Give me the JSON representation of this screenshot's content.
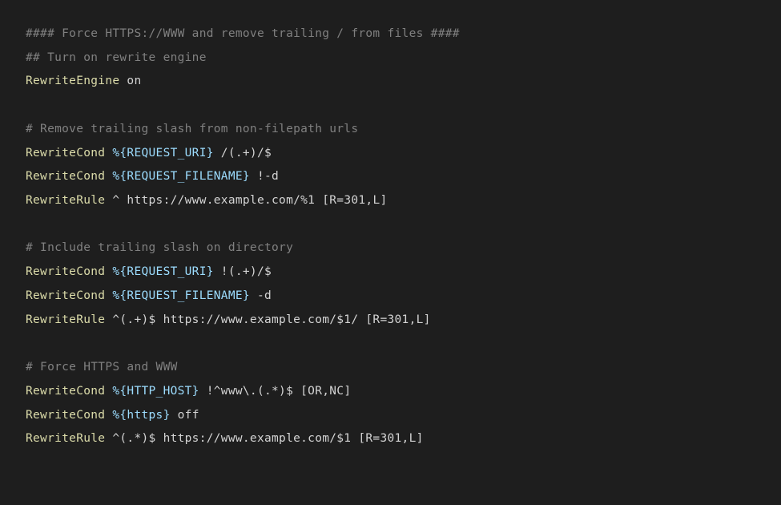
{
  "code": {
    "lines": [
      {
        "segments": [
          {
            "cls": "comment",
            "text": "#### Force HTTPS://WWW and remove trailing / from files ####"
          }
        ]
      },
      {
        "segments": [
          {
            "cls": "comment",
            "text": "## Turn on rewrite engine"
          }
        ]
      },
      {
        "segments": [
          {
            "cls": "directive",
            "text": "RewriteEngine"
          },
          {
            "cls": "value",
            "text": " on"
          }
        ]
      },
      {
        "segments": [
          {
            "cls": "blank",
            "text": " "
          }
        ]
      },
      {
        "segments": [
          {
            "cls": "comment",
            "text": "# Remove trailing slash from non-filepath urls"
          }
        ]
      },
      {
        "segments": [
          {
            "cls": "directive",
            "text": "RewriteCond"
          },
          {
            "cls": "value",
            "text": " "
          },
          {
            "cls": "variable",
            "text": "%{REQUEST_URI}"
          },
          {
            "cls": "value",
            "text": " /(.+)/$"
          }
        ]
      },
      {
        "segments": [
          {
            "cls": "directive",
            "text": "RewriteCond"
          },
          {
            "cls": "value",
            "text": " "
          },
          {
            "cls": "variable",
            "text": "%{REQUEST_FILENAME}"
          },
          {
            "cls": "value",
            "text": " !-d"
          }
        ]
      },
      {
        "segments": [
          {
            "cls": "directive",
            "text": "RewriteRule"
          },
          {
            "cls": "value",
            "text": " ^ https://www.example.com/%1 "
          },
          {
            "cls": "flags",
            "text": "[R=301,L]"
          }
        ]
      },
      {
        "segments": [
          {
            "cls": "blank",
            "text": " "
          }
        ]
      },
      {
        "segments": [
          {
            "cls": "comment",
            "text": "# Include trailing slash on directory"
          }
        ]
      },
      {
        "segments": [
          {
            "cls": "directive",
            "text": "RewriteCond"
          },
          {
            "cls": "value",
            "text": " "
          },
          {
            "cls": "variable",
            "text": "%{REQUEST_URI}"
          },
          {
            "cls": "value",
            "text": " !(.+)/$"
          }
        ]
      },
      {
        "segments": [
          {
            "cls": "directive",
            "text": "RewriteCond"
          },
          {
            "cls": "value",
            "text": " "
          },
          {
            "cls": "variable",
            "text": "%{REQUEST_FILENAME}"
          },
          {
            "cls": "value",
            "text": " -d"
          }
        ]
      },
      {
        "segments": [
          {
            "cls": "directive",
            "text": "RewriteRule"
          },
          {
            "cls": "value",
            "text": " ^(.+)$ https://www.example.com/$1/ "
          },
          {
            "cls": "flags",
            "text": "[R=301,L]"
          }
        ]
      },
      {
        "segments": [
          {
            "cls": "blank",
            "text": " "
          }
        ]
      },
      {
        "segments": [
          {
            "cls": "comment",
            "text": "# Force HTTPS and WWW"
          }
        ]
      },
      {
        "segments": [
          {
            "cls": "directive",
            "text": "RewriteCond"
          },
          {
            "cls": "value",
            "text": " "
          },
          {
            "cls": "variable",
            "text": "%{HTTP_HOST}"
          },
          {
            "cls": "value",
            "text": " !^www\\.(.*)$ "
          },
          {
            "cls": "flags",
            "text": "[OR,NC]"
          }
        ]
      },
      {
        "segments": [
          {
            "cls": "directive",
            "text": "RewriteCond"
          },
          {
            "cls": "value",
            "text": " "
          },
          {
            "cls": "variable",
            "text": "%{https}"
          },
          {
            "cls": "value",
            "text": " off"
          }
        ]
      },
      {
        "segments": [
          {
            "cls": "directive",
            "text": "RewriteRule"
          },
          {
            "cls": "value",
            "text": " ^(.*)$ https://www.example.com/$1 "
          },
          {
            "cls": "flags",
            "text": "[R=301,L]"
          }
        ]
      }
    ]
  }
}
